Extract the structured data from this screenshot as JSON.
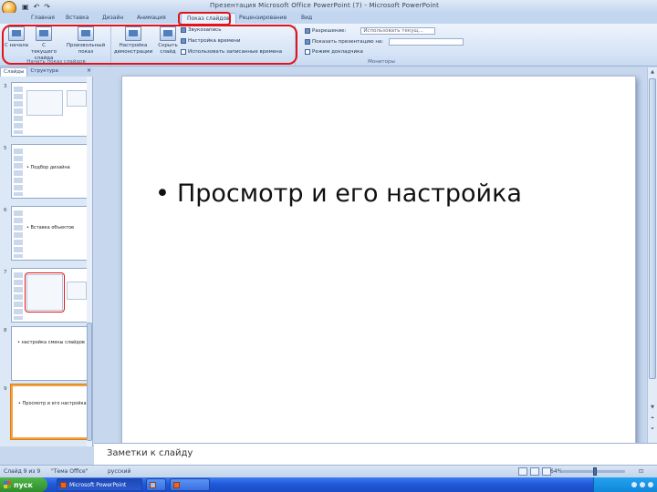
{
  "window": {
    "title": "Презентация Microsoft Office PowerPoint (7) - Microsoft PowerPoint",
    "qat_icons": [
      "save-icon",
      "undo-icon",
      "redo-icon"
    ]
  },
  "tabs": [
    {
      "label": "Главная",
      "active": false
    },
    {
      "label": "Вставка",
      "active": false
    },
    {
      "label": "Дизайн",
      "active": false
    },
    {
      "label": "Анимация",
      "active": false
    },
    {
      "label": "Показ слайдов",
      "active": true
    },
    {
      "label": "Рецензирование",
      "active": false
    },
    {
      "label": "Вид",
      "active": false
    }
  ],
  "ribbon": {
    "group_start": {
      "label": "Начать показ слайдов",
      "btn_from_start": "С начала",
      "btn_from_current": "С текущего слайда",
      "btn_custom": "Произвольный показ"
    },
    "group_setup": {
      "btn_setup": "Настройка демонстрации",
      "btn_hide": "Скрыть слайд",
      "opt_narration": "Звукозапись",
      "opt_rehearse": "Настройка времени",
      "opt_timings": "Использовать записанные времена"
    },
    "group_monitors": {
      "label": "Мониторы",
      "resolution_label": "Разрешение:",
      "resolution_value": "Использовать текущ...",
      "show_on_label": "Показать презентацию на:",
      "show_on_value": "",
      "presenter_view": "Режим докладчика"
    }
  },
  "slides_pane": {
    "tab_slides": "Слайды",
    "tab_outline": "Структура",
    "close_glyph": "×",
    "thumbnails": [
      {
        "number": "3",
        "text": ""
      },
      {
        "number": "5",
        "text": "• Подбор дизайна"
      },
      {
        "number": "6",
        "text": "• Вставка объектов"
      },
      {
        "number": "7",
        "text": ""
      },
      {
        "number": "8",
        "text": "• настройка смены слайдов"
      },
      {
        "number": "9",
        "text": "• Просмотр и его настройка",
        "selected": true
      }
    ]
  },
  "slide": {
    "bullet_char": "•",
    "bullet_text": "Просмотр и его настройка"
  },
  "notes": {
    "placeholder": "Заметки к слайду"
  },
  "statusbar": {
    "slide_info": "Слайд 9 из 9",
    "theme": "\"Тема Office\"",
    "language": "русский",
    "zoom": "64%"
  },
  "taskbar": {
    "start_label": "пуск",
    "items": [
      {
        "label": "Microsoft PowerPoint",
        "active": true
      },
      {
        "label": "",
        "active": false
      },
      {
        "label": "",
        "active": false
      }
    ]
  },
  "colors": {
    "highlight": "#e0141a",
    "ribbon_bg": "#d6e4f6",
    "selected_thumb": "#f3a140"
  }
}
